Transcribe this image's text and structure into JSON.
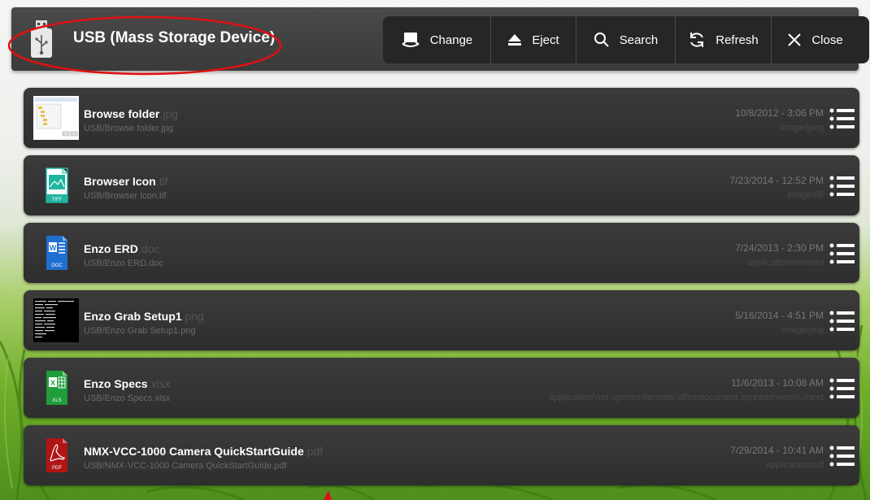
{
  "header": {
    "title": "USB (Mass Storage Device)"
  },
  "toolbar": {
    "buttons": [
      {
        "label": "Change",
        "icon": "change-drive-icon"
      },
      {
        "label": "Eject",
        "icon": "eject-icon"
      },
      {
        "label": "Search",
        "icon": "search-icon"
      },
      {
        "label": "Refresh",
        "icon": "refresh-icon"
      },
      {
        "label": "Close",
        "icon": "close-icon"
      }
    ]
  },
  "files": [
    {
      "name": "Browse folder",
      "ext": ".jpg",
      "path": "USB/Browse folder.jpg",
      "date": "10/8/2012 - 3:06 PM",
      "mime": "image/jpeg",
      "icon": "image-thumbnail"
    },
    {
      "name": "Browser Icon",
      "ext": ".tif",
      "path": "USB/Browser Icon.tif",
      "date": "7/23/2014 - 12:52 PM",
      "mime": "image/tiff",
      "icon": "tiff-file-icon"
    },
    {
      "name": "Enzo ERD",
      "ext": ".doc",
      "path": "USB/Enzo ERD.doc",
      "date": "7/24/2013 - 2:30 PM",
      "mime": "application/msword",
      "icon": "word-doc-icon"
    },
    {
      "name": "Enzo Grab Setup1",
      "ext": ".png",
      "path": "USB/Enzo Grab Setup1.png",
      "date": "5/16/2014 - 4:51 PM",
      "mime": "image/png",
      "icon": "image-thumbnail"
    },
    {
      "name": "Enzo Specs",
      "ext": ".xlsx",
      "path": "USB/Enzo Specs.xlsx",
      "date": "11/6/2013 - 10:08 AM",
      "mime": "application/vnd.openxmlformats-officedocument.spreadsheetml.sheet",
      "icon": "excel-xls-icon"
    },
    {
      "name": "NMX-VCC-1000 Camera QuickStartGuide",
      "ext": ".pdf",
      "path": "USB/NMX-VCC-1000 Camera QuickStartGuide.pdf",
      "date": "7/29/2014 - 10:41 AM",
      "mime": "application/pdf",
      "icon": "pdf-file-icon"
    }
  ],
  "colors": {
    "header_bg": "#3f3f3f",
    "toolbar_bg": "#262626",
    "row_bg": "#333333",
    "highlight": "#e01010",
    "tiff_accent": "#1fb5a0",
    "word_accent": "#1e6fd0",
    "excel_accent": "#1f9d3a",
    "pdf_accent": "#b01515"
  }
}
